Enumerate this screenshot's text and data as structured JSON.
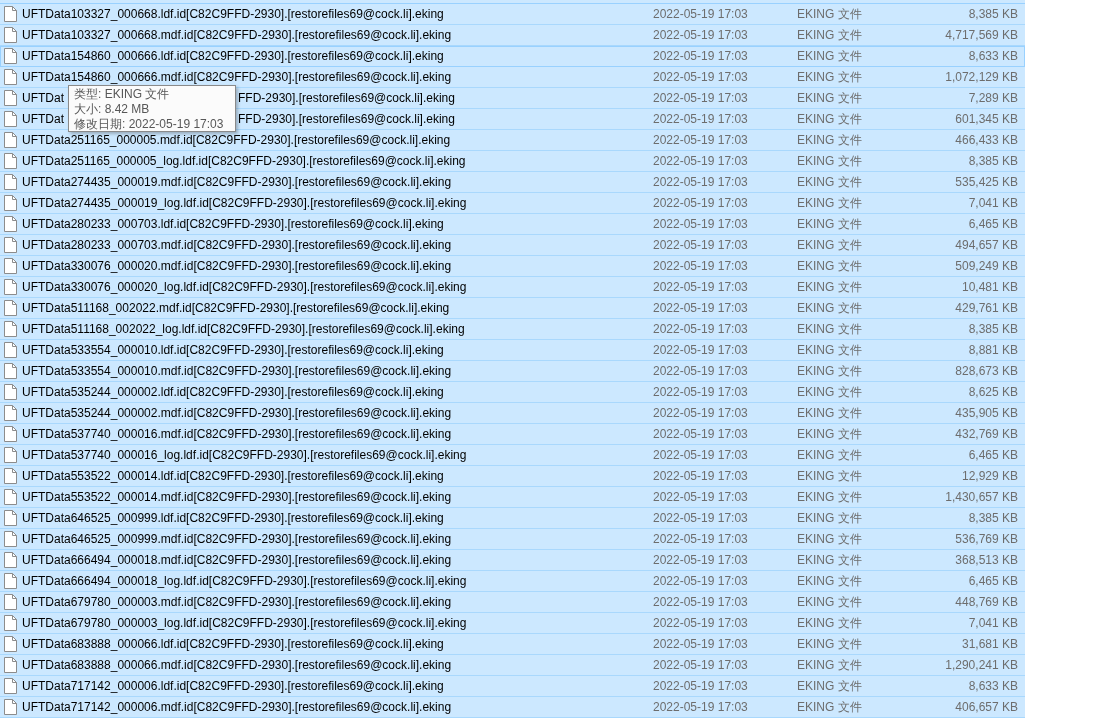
{
  "file_list": {
    "rows": [
      {
        "name": "UFTData103327_000668.ldf.id[C82C9FFD-2930].[restorefiles69@cock.li].eking",
        "date": "2022-05-19 17:03",
        "type": "EKING 文件",
        "size": "8,385 KB",
        "selected": true,
        "focused": false
      },
      {
        "name": "UFTData103327_000668.mdf.id[C82C9FFD-2930].[restorefiles69@cock.li].eking",
        "date": "2022-05-19 17:03",
        "type": "EKING 文件",
        "size": "4,717,569 KB",
        "selected": true,
        "focused": false
      },
      {
        "name": "UFTData154860_000666.ldf.id[C82C9FFD-2930].[restorefiles69@cock.li].eking",
        "date": "2022-05-19 17:03",
        "type": "EKING 文件",
        "size": "8,633 KB",
        "selected": true,
        "focused": true
      },
      {
        "name": "UFTData154860_000666.mdf.id[C82C9FFD-2930].[restorefiles69@cock.li].eking",
        "date": "2022-05-19 17:03",
        "type": "EKING 文件",
        "size": "1,072,129 KB",
        "selected": true,
        "focused": false
      },
      {
        "name_parts": [
          "UFTDat",
          "FFD-2930].[restorefiles69@cock.li].eking"
        ],
        "date": "2022-05-19 17:03",
        "type": "EKING 文件",
        "size": "7,289 KB",
        "selected": true,
        "focused": false
      },
      {
        "name_parts": [
          "UFTDat",
          "FFD-2930].[restorefiles69@cock.li].eking"
        ],
        "date": "2022-05-19 17:03",
        "type": "EKING 文件",
        "size": "601,345 KB",
        "selected": true,
        "focused": false
      },
      {
        "name": "UFTData251165_000005.mdf.id[C82C9FFD-2930].[restorefiles69@cock.li].eking",
        "date": "2022-05-19 17:03",
        "type": "EKING 文件",
        "size": "466,433 KB",
        "selected": true,
        "focused": false
      },
      {
        "name": "UFTData251165_000005_log.ldf.id[C82C9FFD-2930].[restorefiles69@cock.li].eking",
        "date": "2022-05-19 17:03",
        "type": "EKING 文件",
        "size": "8,385 KB",
        "selected": true,
        "focused": false
      },
      {
        "name": "UFTData274435_000019.mdf.id[C82C9FFD-2930].[restorefiles69@cock.li].eking",
        "date": "2022-05-19 17:03",
        "type": "EKING 文件",
        "size": "535,425 KB",
        "selected": true,
        "focused": false
      },
      {
        "name": "UFTData274435_000019_log.ldf.id[C82C9FFD-2930].[restorefiles69@cock.li].eking",
        "date": "2022-05-19 17:03",
        "type": "EKING 文件",
        "size": "7,041 KB",
        "selected": true,
        "focused": false
      },
      {
        "name": "UFTData280233_000703.ldf.id[C82C9FFD-2930].[restorefiles69@cock.li].eking",
        "date": "2022-05-19 17:03",
        "type": "EKING 文件",
        "size": "6,465 KB",
        "selected": true,
        "focused": false
      },
      {
        "name": "UFTData280233_000703.mdf.id[C82C9FFD-2930].[restorefiles69@cock.li].eking",
        "date": "2022-05-19 17:03",
        "type": "EKING 文件",
        "size": "494,657 KB",
        "selected": true,
        "focused": false
      },
      {
        "name": "UFTData330076_000020.mdf.id[C82C9FFD-2930].[restorefiles69@cock.li].eking",
        "date": "2022-05-19 17:03",
        "type": "EKING 文件",
        "size": "509,249 KB",
        "selected": true,
        "focused": false
      },
      {
        "name": "UFTData330076_000020_log.ldf.id[C82C9FFD-2930].[restorefiles69@cock.li].eking",
        "date": "2022-05-19 17:03",
        "type": "EKING 文件",
        "size": "10,481 KB",
        "selected": true,
        "focused": false
      },
      {
        "name": "UFTData511168_002022.mdf.id[C82C9FFD-2930].[restorefiles69@cock.li].eking",
        "date": "2022-05-19 17:03",
        "type": "EKING 文件",
        "size": "429,761 KB",
        "selected": true,
        "focused": false
      },
      {
        "name": "UFTData511168_002022_log.ldf.id[C82C9FFD-2930].[restorefiles69@cock.li].eking",
        "date": "2022-05-19 17:03",
        "type": "EKING 文件",
        "size": "8,385 KB",
        "selected": true,
        "focused": false
      },
      {
        "name": "UFTData533554_000010.ldf.id[C82C9FFD-2930].[restorefiles69@cock.li].eking",
        "date": "2022-05-19 17:03",
        "type": "EKING 文件",
        "size": "8,881 KB",
        "selected": true,
        "focused": false
      },
      {
        "name": "UFTData533554_000010.mdf.id[C82C9FFD-2930].[restorefiles69@cock.li].eking",
        "date": "2022-05-19 17:03",
        "type": "EKING 文件",
        "size": "828,673 KB",
        "selected": true,
        "focused": false
      },
      {
        "name": "UFTData535244_000002.ldf.id[C82C9FFD-2930].[restorefiles69@cock.li].eking",
        "date": "2022-05-19 17:03",
        "type": "EKING 文件",
        "size": "8,625 KB",
        "selected": true,
        "focused": false
      },
      {
        "name": "UFTData535244_000002.mdf.id[C82C9FFD-2930].[restorefiles69@cock.li].eking",
        "date": "2022-05-19 17:03",
        "type": "EKING 文件",
        "size": "435,905 KB",
        "selected": true,
        "focused": false
      },
      {
        "name": "UFTData537740_000016.mdf.id[C82C9FFD-2930].[restorefiles69@cock.li].eking",
        "date": "2022-05-19 17:03",
        "type": "EKING 文件",
        "size": "432,769 KB",
        "selected": true,
        "focused": false
      },
      {
        "name": "UFTData537740_000016_log.ldf.id[C82C9FFD-2930].[restorefiles69@cock.li].eking",
        "date": "2022-05-19 17:03",
        "type": "EKING 文件",
        "size": "6,465 KB",
        "selected": true,
        "focused": false
      },
      {
        "name": "UFTData553522_000014.ldf.id[C82C9FFD-2930].[restorefiles69@cock.li].eking",
        "date": "2022-05-19 17:03",
        "type": "EKING 文件",
        "size": "12,929 KB",
        "selected": true,
        "focused": false
      },
      {
        "name": "UFTData553522_000014.mdf.id[C82C9FFD-2930].[restorefiles69@cock.li].eking",
        "date": "2022-05-19 17:03",
        "type": "EKING 文件",
        "size": "1,430,657 KB",
        "selected": true,
        "focused": false
      },
      {
        "name": "UFTData646525_000999.ldf.id[C82C9FFD-2930].[restorefiles69@cock.li].eking",
        "date": "2022-05-19 17:03",
        "type": "EKING 文件",
        "size": "8,385 KB",
        "selected": true,
        "focused": false
      },
      {
        "name": "UFTData646525_000999.mdf.id[C82C9FFD-2930].[restorefiles69@cock.li].eking",
        "date": "2022-05-19 17:03",
        "type": "EKING 文件",
        "size": "536,769 KB",
        "selected": true,
        "focused": false
      },
      {
        "name": "UFTData666494_000018.mdf.id[C82C9FFD-2930].[restorefiles69@cock.li].eking",
        "date": "2022-05-19 17:03",
        "type": "EKING 文件",
        "size": "368,513 KB",
        "selected": true,
        "focused": false
      },
      {
        "name": "UFTData666494_000018_log.ldf.id[C82C9FFD-2930].[restorefiles69@cock.li].eking",
        "date": "2022-05-19 17:03",
        "type": "EKING 文件",
        "size": "6,465 KB",
        "selected": true,
        "focused": false
      },
      {
        "name": "UFTData679780_000003.mdf.id[C82C9FFD-2930].[restorefiles69@cock.li].eking",
        "date": "2022-05-19 17:03",
        "type": "EKING 文件",
        "size": "448,769 KB",
        "selected": true,
        "focused": false
      },
      {
        "name": "UFTData679780_000003_log.ldf.id[C82C9FFD-2930].[restorefiles69@cock.li].eking",
        "date": "2022-05-19 17:03",
        "type": "EKING 文件",
        "size": "7,041 KB",
        "selected": true,
        "focused": false
      },
      {
        "name": "UFTData683888_000066.ldf.id[C82C9FFD-2930].[restorefiles69@cock.li].eking",
        "date": "2022-05-19 17:03",
        "type": "EKING 文件",
        "size": "31,681 KB",
        "selected": true,
        "focused": false
      },
      {
        "name": "UFTData683888_000066.mdf.id[C82C9FFD-2930].[restorefiles69@cock.li].eking",
        "date": "2022-05-19 17:03",
        "type": "EKING 文件",
        "size": "1,290,241 KB",
        "selected": true,
        "focused": false
      },
      {
        "name": "UFTData717142_000006.ldf.id[C82C9FFD-2930].[restorefiles69@cock.li].eking",
        "date": "2022-05-19 17:03",
        "type": "EKING 文件",
        "size": "8,633 KB",
        "selected": true,
        "focused": false
      },
      {
        "name": "UFTData717142_000006.mdf.id[C82C9FFD-2930].[restorefiles69@cock.li].eking",
        "date": "2022-05-19 17:03",
        "type": "EKING 文件",
        "size": "406,657 KB",
        "selected": true,
        "focused": false
      }
    ]
  },
  "tooltip": {
    "lines": [
      "类型: EKING 文件",
      "大小: 8.42 MB",
      "修改日期: 2022-05-19 17:03"
    ]
  }
}
